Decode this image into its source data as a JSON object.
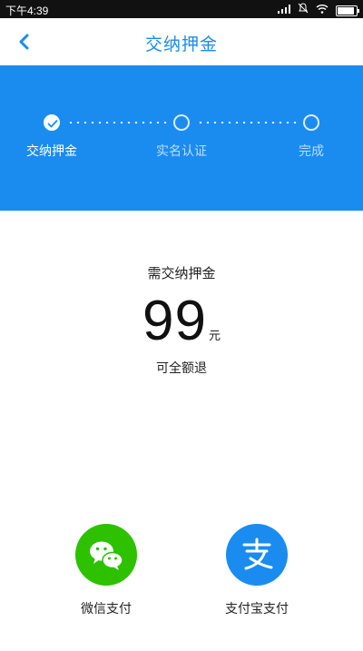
{
  "status_bar": {
    "time": "下午4:39",
    "icons": [
      "signal-icon",
      "alarm-off-icon",
      "wifi-icon",
      "battery-icon"
    ]
  },
  "nav": {
    "title": "交纳押金",
    "back_icon": "chevron-left-icon"
  },
  "steps": [
    {
      "label": "交纳押金",
      "state": "done"
    },
    {
      "label": "实名认证",
      "state": "todo"
    },
    {
      "label": "完成",
      "state": "todo"
    }
  ],
  "deposit": {
    "title": "需交纳押金",
    "amount": "99",
    "unit": "元",
    "refund_note": "可全额退"
  },
  "payment": [
    {
      "label": "微信支付",
      "icon": "wechat-icon",
      "color": "#2dc100"
    },
    {
      "label": "支付宝支付",
      "icon": "alipay-icon",
      "color": "#1a8cf0"
    }
  ],
  "colors": {
    "accent": "#1a8cf0",
    "wechat": "#2dc100"
  }
}
